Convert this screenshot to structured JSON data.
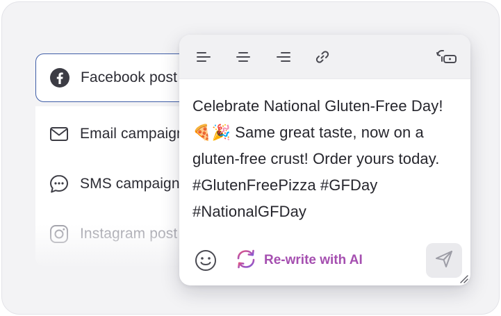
{
  "channels": {
    "selected": {
      "label": "Facebook post",
      "icon": "facebook-icon"
    },
    "items": [
      {
        "label": "Email campaign",
        "icon": "mail-icon"
      },
      {
        "label": "SMS campaign",
        "icon": "chat-bubble-icon"
      },
      {
        "label": "Instagram post",
        "icon": "instagram-icon"
      }
    ]
  },
  "editor": {
    "toolbar": {
      "buttons": [
        "align-left-icon",
        "align-center-icon",
        "align-right-icon",
        "link-icon",
        "unlink-icon"
      ]
    },
    "post_text": "Celebrate National Gluten-Free Day! 🍕🎉 Same great taste, now on a gluten-free crust! Order yours today. #GlutenFreePizza #GFDay #NationalGFDay",
    "ai_button_label": "Re-write with AI",
    "colors": {
      "accent_ai": "#a54fb0",
      "selected_border": "#3d5ca6",
      "toolbar_bg": "#f1f1f3"
    }
  }
}
